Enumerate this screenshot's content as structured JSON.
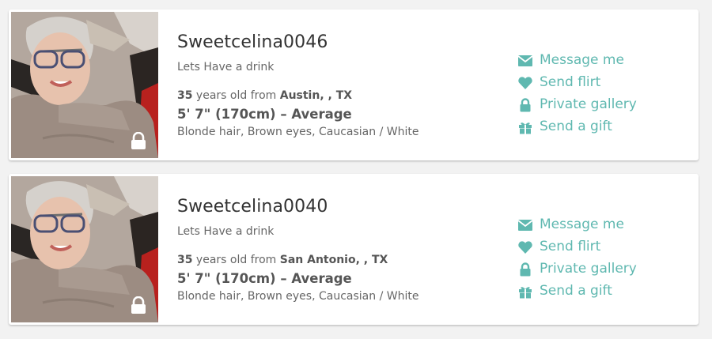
{
  "colors": {
    "accent": "#5fb8b0",
    "text": "#333333",
    "muted": "#666666"
  },
  "profiles": [
    {
      "username": "Sweetcelina0046",
      "tagline": "Lets Have a drink",
      "age": "35",
      "age_text": " years old from ",
      "location": "Austin, , TX",
      "height": "5' 7\" (170cm) – Average",
      "features": "Blonde hair, Brown eyes, Caucasian / White",
      "photo_locked": true
    },
    {
      "username": "Sweetcelina0040",
      "tagline": "Lets Have a drink",
      "age": "35",
      "age_text": " years old from ",
      "location": "San Antonio, , TX",
      "height": "5' 7\" (170cm) – Average",
      "features": "Blonde hair, Brown eyes, Caucasian / White",
      "photo_locked": true
    }
  ],
  "actions": [
    {
      "label": "Message me",
      "icon": "envelope-icon"
    },
    {
      "label": "Send flirt",
      "icon": "heart-icon"
    },
    {
      "label": "Private gallery",
      "icon": "lock-icon"
    },
    {
      "label": "Send a gift",
      "icon": "gift-icon"
    }
  ]
}
